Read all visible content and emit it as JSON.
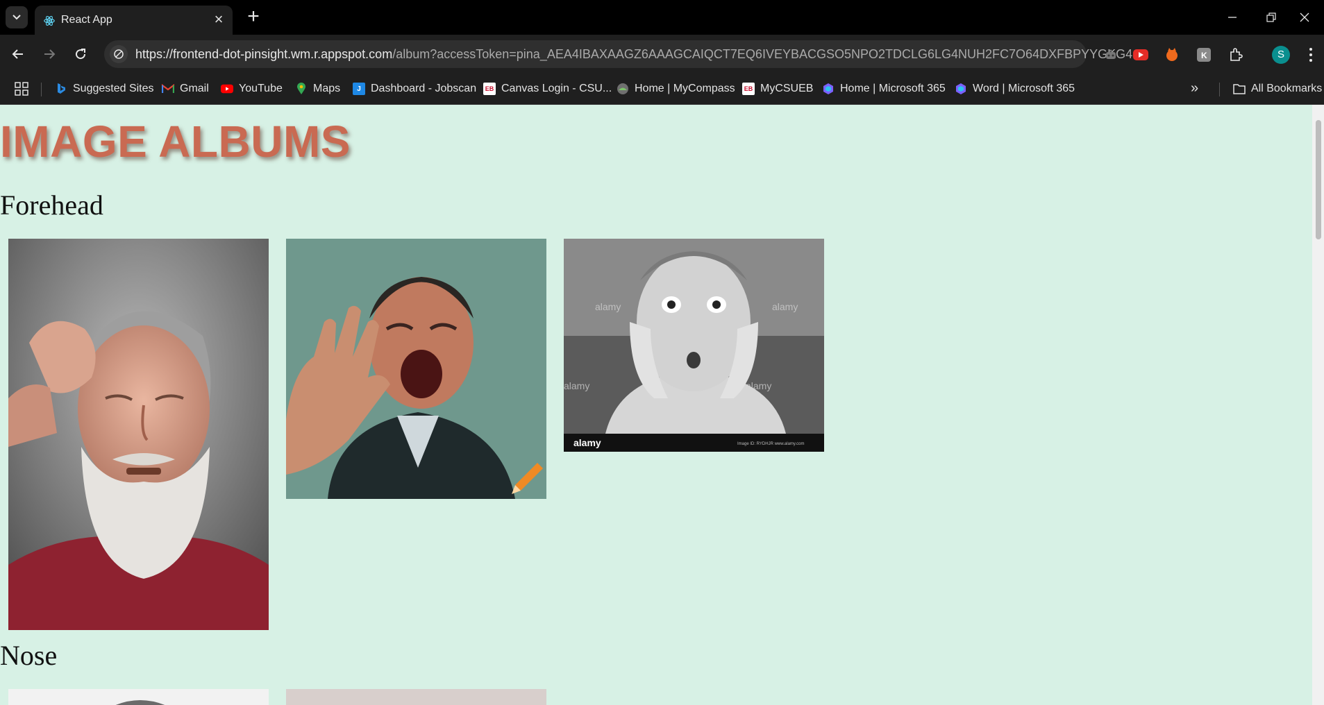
{
  "browser": {
    "tab_title": "React App",
    "url_host": "https://frontend-dot-pinsight.wm.r.appspot.com",
    "url_rest": "/album?accessToken=pina_AEA4IBAXAAGZ6AAAGCAIQCT7EQ6IVEYBACGSO5NPO2TDCLG6LG4NUH2FC7O64DXFBPYYGKG4...",
    "profile_initial": "S",
    "bookmarks": [
      {
        "label": "Suggested Sites",
        "icon": "bing-icon"
      },
      {
        "label": "Gmail",
        "icon": "gmail-icon"
      },
      {
        "label": "YouTube",
        "icon": "youtube-icon"
      },
      {
        "label": "Maps",
        "icon": "maps-icon"
      },
      {
        "label": "Dashboard - Jobscan",
        "icon": "jobscan-icon"
      },
      {
        "label": "Canvas Login - CSU...",
        "icon": "eb-icon"
      },
      {
        "label": "Home | MyCompass",
        "icon": "mycompass-icon"
      },
      {
        "label": "MyCSUEB",
        "icon": "eb-icon"
      },
      {
        "label": "Home | Microsoft 365",
        "icon": "m365-icon"
      },
      {
        "label": "Word | Microsoft 365",
        "icon": "m365-icon"
      }
    ],
    "all_bookmarks": "All Bookmarks",
    "more_bookmarks": "»"
  },
  "page": {
    "title": "IMAGE ALBUMS",
    "albums": [
      {
        "name": "Forehead",
        "photos": [
          "gray-bearded-man-scratching-head",
          "man-shouting-raised-hand",
          "surprised-boy-hands-on-cheeks"
        ]
      },
      {
        "name": "Nose",
        "photos": [
          "nose-photo-1",
          "nose-photo-2"
        ]
      }
    ],
    "watermark": "alamy",
    "watermark_small": "Image ID: RYDHJR www.alamy.com"
  }
}
